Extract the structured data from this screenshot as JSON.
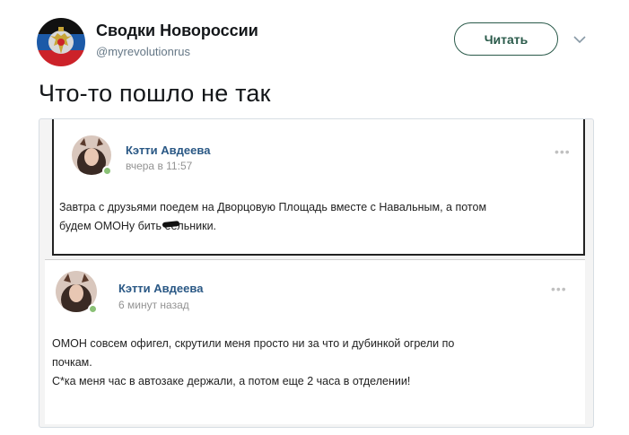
{
  "tweet": {
    "author_name": "Сводки Новороссии",
    "author_handle": "@myrevolutionrus",
    "follow_label": "Читать",
    "text": "Что-то пошло не так",
    "colors": {
      "name": "#14171a",
      "handle": "#657786",
      "follow": "#2a5a4a"
    }
  },
  "screenshot": {
    "posts": [
      {
        "author": "Кэтти Авдеева",
        "time": "вчера в 11:57",
        "text_line1": "Завтра с друзьями поедем на Дворцовую Площадь вместе с Навальным, а потом",
        "text_line2_start": "будем ОМОНу бить ",
        "text_line2_redacted": "ее",
        "text_line2_end": "льники."
      },
      {
        "author": "Кэтти Авдеева",
        "time": "6 минут назад",
        "text_line1": "ОМОН совсем офигел, скрутили меня просто ни за что и дубинкой огрели по",
        "text_line2": "почкам.",
        "text_line3": "С*ка меня час в автозаке держали, а потом еще 2 часа в отделении!"
      }
    ],
    "colors": {
      "vk_name": "#2a5885",
      "vk_time": "#939393",
      "online": "#8ac176"
    }
  },
  "icons": {
    "avatar_emblem": "double-headed-eagle-icon",
    "caret": "chevron-down-icon",
    "menu": "more-dots-icon"
  }
}
